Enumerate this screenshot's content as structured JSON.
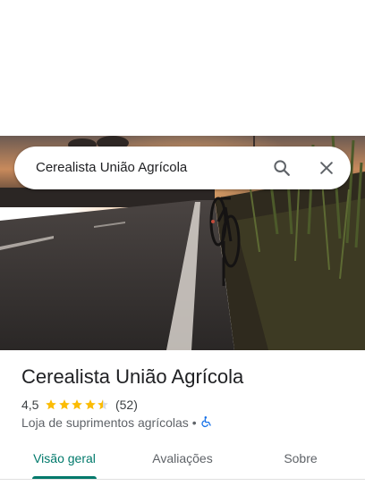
{
  "search": {
    "query": "Cerealista União Agrícola",
    "search_icon": "search-icon",
    "close_icon": "close-icon"
  },
  "place": {
    "name": "Cerealista União Agrícola",
    "rating": "4,5",
    "rating_value": 4.5,
    "stars_max": 5,
    "review_count": "(52)",
    "category": "Loja de suprimentos agrícolas",
    "separator": "•",
    "accessibility_icon": "wheelchair-accessible-icon"
  },
  "tabs": [
    {
      "label": "Visão geral",
      "active": true
    },
    {
      "label": "Avaliações",
      "active": false
    },
    {
      "label": "Sobre",
      "active": false
    }
  ],
  "colors": {
    "accent": "#00796b",
    "star": "#fbbc04",
    "accessibility": "#1a73e8"
  }
}
